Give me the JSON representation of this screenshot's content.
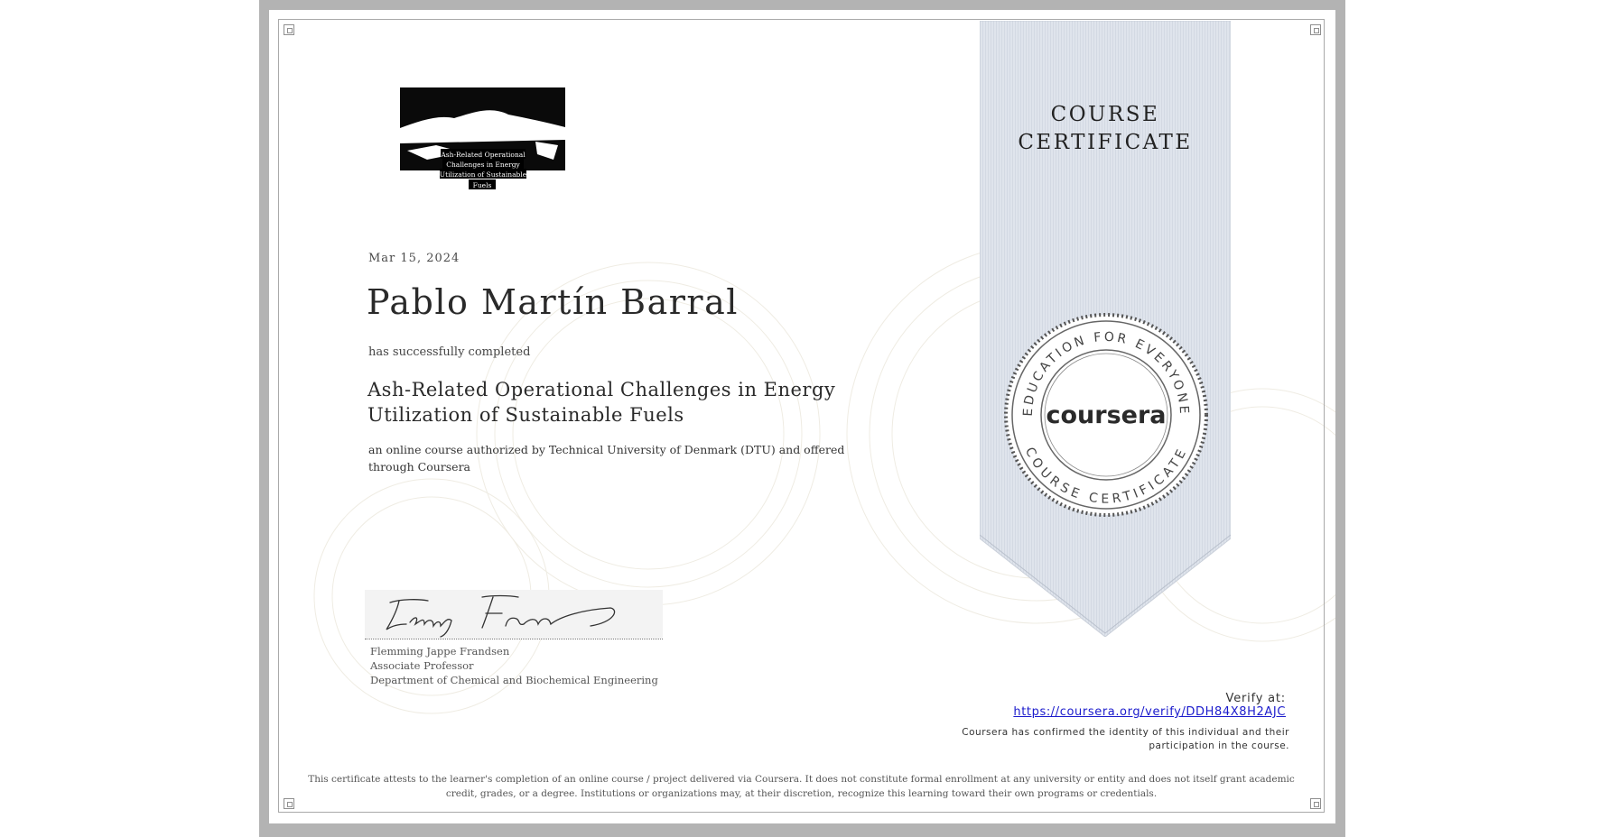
{
  "certificate": {
    "ribbon_title_line1": "COURSE",
    "ribbon_title_line2": "CERTIFICATE",
    "date": "Mar 15, 2024",
    "recipient_name": "Pablo Martín Barral",
    "completed_text": "has successfully completed",
    "course_title": "Ash-Related Operational Challenges in Energy Utilization of Sustainable Fuels",
    "authorized_text": "an online course authorized by Technical University of Denmark (DTU) and offered through Coursera",
    "logo_text": [
      "Ash-Related Operational",
      "Challenges in Energy",
      "Utilization of Sustainable",
      "Fuels"
    ]
  },
  "signature": {
    "signer_name": "Flemming Jappe Frandsen",
    "signer_title": "Associate Professor",
    "signer_department": "Department of Chemical and Biochemical Engineering"
  },
  "seal": {
    "top_text": "EDUCATION FOR EVERYONE",
    "brand": "coursera",
    "bottom_text": "COURSE CERTIFICATE"
  },
  "verification": {
    "label": "Verify at:",
    "url": "https://coursera.org/verify/DDH84X8H2AJC",
    "confirmation": "Coursera has confirmed the identity of this individual and their participation in the course."
  },
  "footer": {
    "attestation": "This certificate attests to the learner's completion of an online course / project delivered via Coursera. It does not constitute formal enrollment at any university or entity and does not itself grant academic credit, grades, or a degree. Institutions or organizations may, at their discretion, recognize this learning toward their own programs or credentials."
  },
  "colors": {
    "frame": "#b3b3b3",
    "ribbon": "#dde3ec",
    "link": "#1a1acc"
  }
}
